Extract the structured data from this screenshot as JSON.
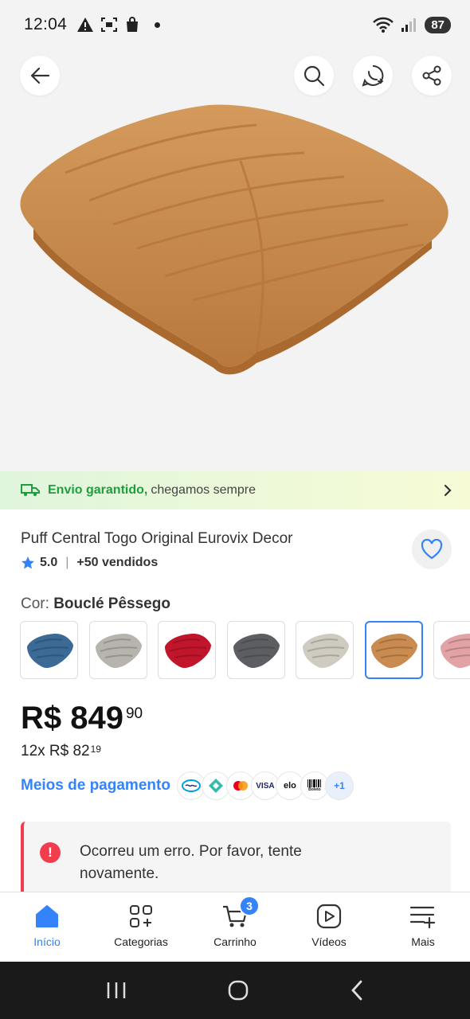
{
  "status_bar": {
    "time": "12:04",
    "battery": "87"
  },
  "shipping": {
    "strong": "Envio garantido,",
    "rest": "chegamos sempre"
  },
  "product": {
    "title": "Puff Central Togo Original Eurovix Decor",
    "rating": "5.0",
    "sold": "+50 vendidos",
    "color_prefix": "Cor:",
    "color_value": "Bouclé Pêssego"
  },
  "swatches": [
    {
      "color": "#3a6a95"
    },
    {
      "color": "#b7b3ad"
    },
    {
      "color": "#c0152a"
    },
    {
      "color": "#5c5e61"
    },
    {
      "color": "#cfcbc1"
    },
    {
      "color": "#c98b4f",
      "selected": true
    },
    {
      "color": "#e2a2a6"
    }
  ],
  "price": {
    "main": "R$ 849",
    "cents": "90"
  },
  "installments": {
    "text": "12x R$ 82",
    "cents": "19"
  },
  "payments": {
    "link": "Meios de pagamento",
    "methods": [
      "mercado-pago-icon",
      "pix-icon",
      "mastercard-icon",
      "visa-icon",
      "elo-icon",
      "boleto-icon"
    ],
    "visa": "VISA",
    "elo": "elo",
    "boleto": "Boleto",
    "more": "+1"
  },
  "error": {
    "message": "Ocorreu um erro. Por favor, tente novamente."
  },
  "bottom_nav": [
    {
      "label": "Início",
      "active": true
    },
    {
      "label": "Categorias"
    },
    {
      "label": "Carrinho",
      "badge": "3"
    },
    {
      "label": "Vídeos"
    },
    {
      "label": "Mais"
    }
  ],
  "colors": {
    "accent": "#3483fa",
    "success": "#1f9d3f",
    "error": "#f23d4f"
  }
}
